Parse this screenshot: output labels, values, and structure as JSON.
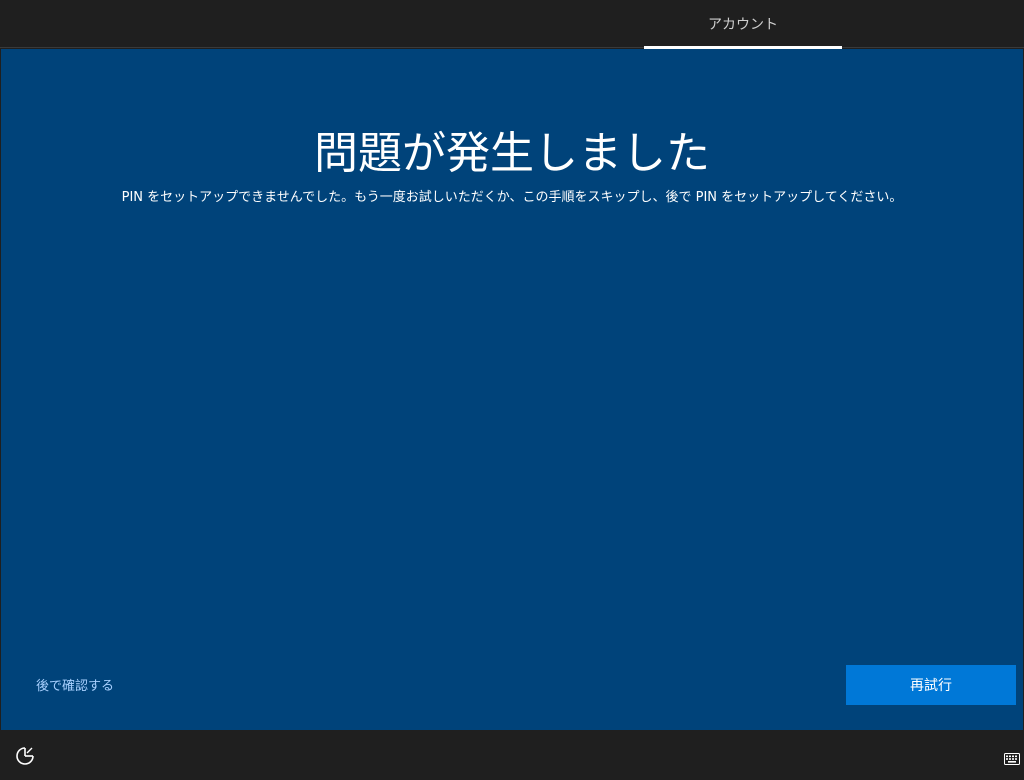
{
  "header": {
    "current_step": "アカウント"
  },
  "main": {
    "title": "問題が発生しました",
    "description": "PIN をセットアップできませんでした。もう一度お試しいただくか、この手順をスキップし、後で PIN をセットアップしてください。"
  },
  "actions": {
    "later_label": "後で確認する",
    "retry_label": "再試行"
  },
  "footer": {
    "left_icon": "accessibility-icon",
    "right_icon": "keyboard-icon"
  },
  "colors": {
    "main_background": "#00437a",
    "bars_background": "#1f1f1f",
    "accent_button": "#0078d7",
    "link": "#a9d1ff"
  }
}
